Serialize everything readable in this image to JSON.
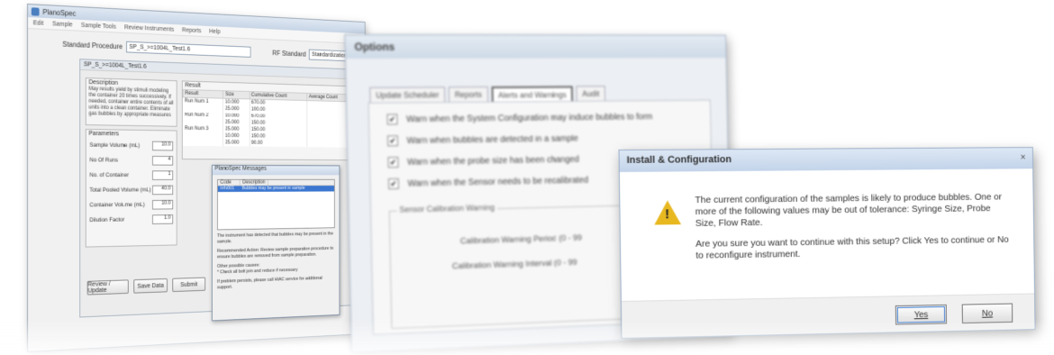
{
  "win1": {
    "title": "PlanoSpec",
    "menu": [
      "Edit",
      "Sample",
      "Sample Tools",
      "Review Instruments",
      "Reports",
      "Help"
    ],
    "standard_label": "Standard Procedure",
    "standard_value": "SP_S_>=1004L_Test1.6",
    "rf_standard_label": "RF Standard",
    "rf_standard_value": "Standardization_Nov",
    "panel_title": "SP_S_>=1004L_Test1.6",
    "description_label": "Description",
    "description_text": "May results yield by stimuli modeling the container 20 times successively. If needed, container entire contents of all units into a clean container. Eliminate gas bubbles by appropriate measures",
    "parameters_label": "Parameters",
    "params": [
      {
        "label": "Sample Volume (mL)",
        "value": "10.0"
      },
      {
        "label": "No Of Runs",
        "value": "4"
      },
      {
        "label": "No. of Container",
        "value": "1"
      },
      {
        "label": "Total Pooled Volume (mL)",
        "value": "40.0"
      },
      {
        "label": "Container Volume (mL)",
        "value": "10.0"
      },
      {
        "label": "Dilution Factor",
        "value": "1.0"
      }
    ],
    "result_label": "Result",
    "result_cols": [
      "Result",
      "Size",
      "Cumulative Count",
      "Average Count"
    ],
    "result_rows": [
      [
        "Run Num 1",
        "10.000",
        "670.00",
        ""
      ],
      [
        "",
        "25.000",
        "100.00",
        ""
      ],
      [
        "Run Num 2",
        "10.000",
        "670.00",
        ""
      ],
      [
        "",
        "25.000",
        "150.00",
        ""
      ],
      [
        "Run Num 3",
        "25.000",
        "150.00",
        ""
      ],
      [
        "",
        "10.000",
        "150.00",
        ""
      ],
      [
        "",
        "25.000",
        "90.00",
        ""
      ]
    ],
    "buttons": {
      "review": "Review / Update",
      "save": "Save Data",
      "submit": "Submit"
    },
    "messages": {
      "title": "PlanoSpec Messages",
      "cols": [
        "Code",
        "Description"
      ],
      "selected_code": "Info001",
      "selected_desc": "Bubbles may be present in sample",
      "text1": "The instrument has detected that bubbles may be present in the sample.",
      "text2": "Recommended Action: Review sample preparation procedure to ensure bubbles are removed from sample preparation.",
      "text3": "Other possible causes:",
      "text4": "* Check all bolt join and reduce if necessary",
      "text5": "If problem persists, please call HIAC service for additional support."
    }
  },
  "win2": {
    "title": "Options",
    "tabs": [
      "Update Scheduler",
      "Reports",
      "Alerts and Warnings",
      "Audit"
    ],
    "active_tab": 2,
    "checks": [
      "Warn when the System Configuration may induce bubbles to form",
      "Warn when bubbles are detected in a sample",
      "Warn when the probe size has been changed",
      "Warn when the Sensor needs to be recalibrated"
    ],
    "group_title": "Sensor Calibration Warning",
    "line1": "Calibration Warning Period (0 - 99",
    "line2": "Calibration Warning Interval (0 - 99"
  },
  "win3": {
    "title": "Install & Configuration",
    "close": "×",
    "para1": "The current configuration of the samples is likely to produce bubbles. One or more of the following values may be out of tolerance: Syringe Size, Probe Size, Flow Rate.",
    "para2": "Are you sure you want to continue with this setup? Click Yes to continue or No to reconfigure instrument.",
    "yes": "Yes",
    "no": "No"
  },
  "colors": {
    "accent": "#3b76d0",
    "warning": "#e8b820"
  }
}
